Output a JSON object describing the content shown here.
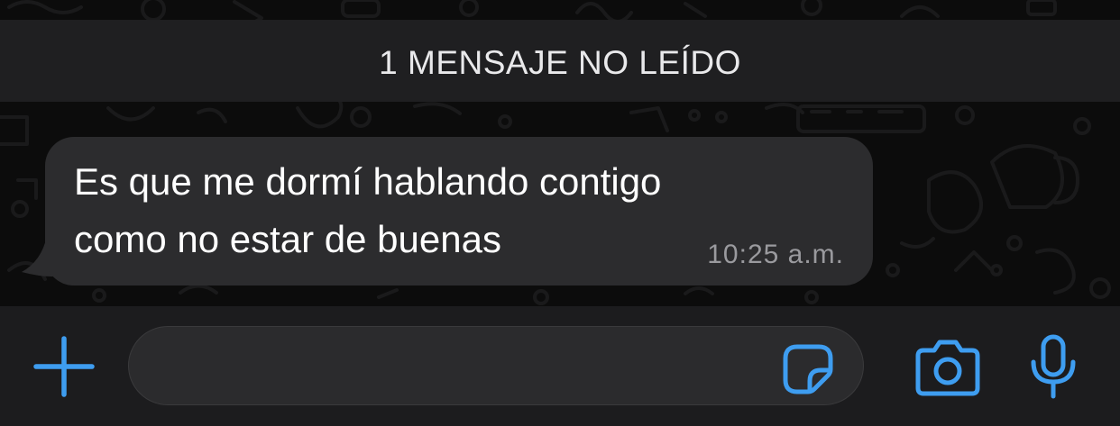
{
  "unread_banner": {
    "text": "1 MENSAJE NO LEÍDO"
  },
  "message": {
    "text": "Es que me dormí hablando contigo\ncomo no estar de buenas",
    "time": "10:25 a.m.",
    "direction": "incoming"
  },
  "composer": {
    "input_value": "",
    "input_placeholder": "",
    "icons": {
      "attach": "plus-icon",
      "sticker": "sticker-icon",
      "camera": "camera-icon",
      "microphone": "microphone-icon"
    }
  },
  "colors": {
    "accent": "#3e9df0",
    "bubble": "#2c2c2e",
    "banner": "#1f1f21",
    "background": "#0c0c0c",
    "input_bar": "#1c1c1e"
  }
}
